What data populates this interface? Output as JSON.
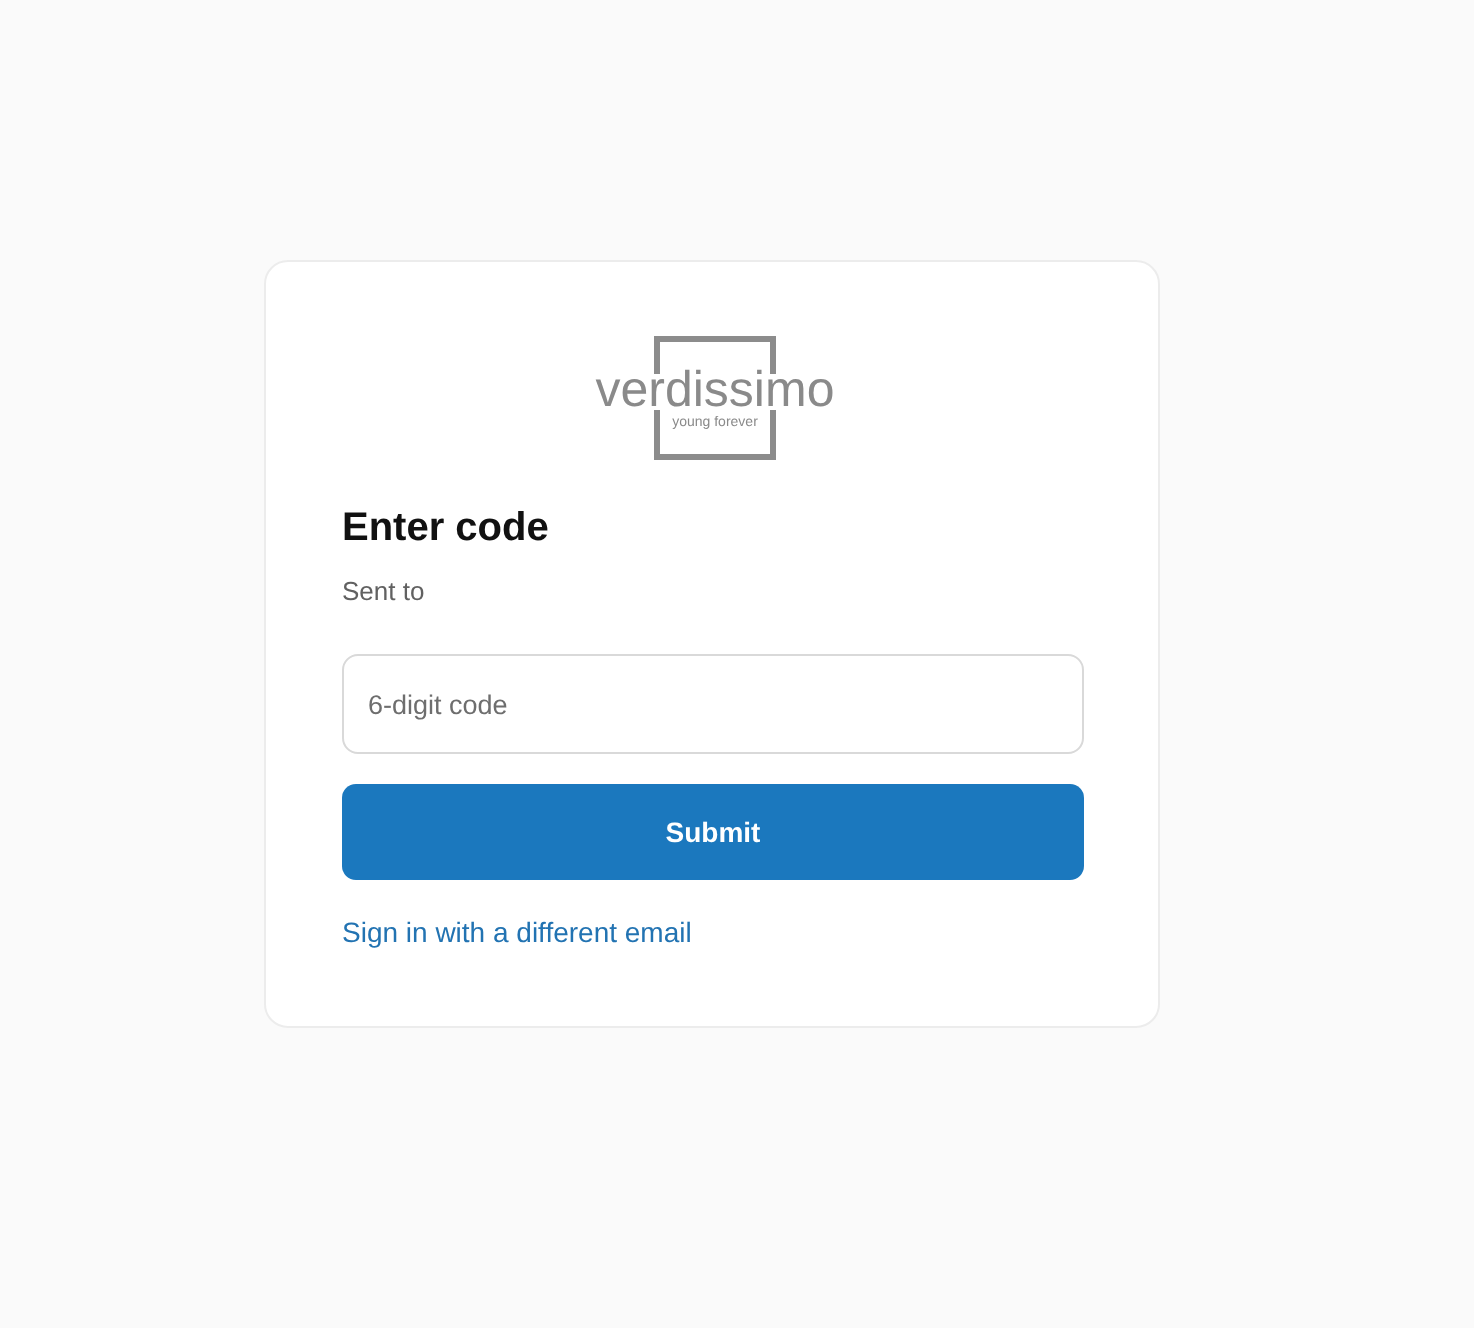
{
  "logo": {
    "wordmark": "verdissimo",
    "tagline": "young forever"
  },
  "heading": "Enter code",
  "subtitle": "Sent to",
  "code_field": {
    "placeholder": "6-digit code"
  },
  "submit_button": {
    "label": "Submit"
  },
  "alternate_link": {
    "label": "Sign in with a different email"
  }
}
